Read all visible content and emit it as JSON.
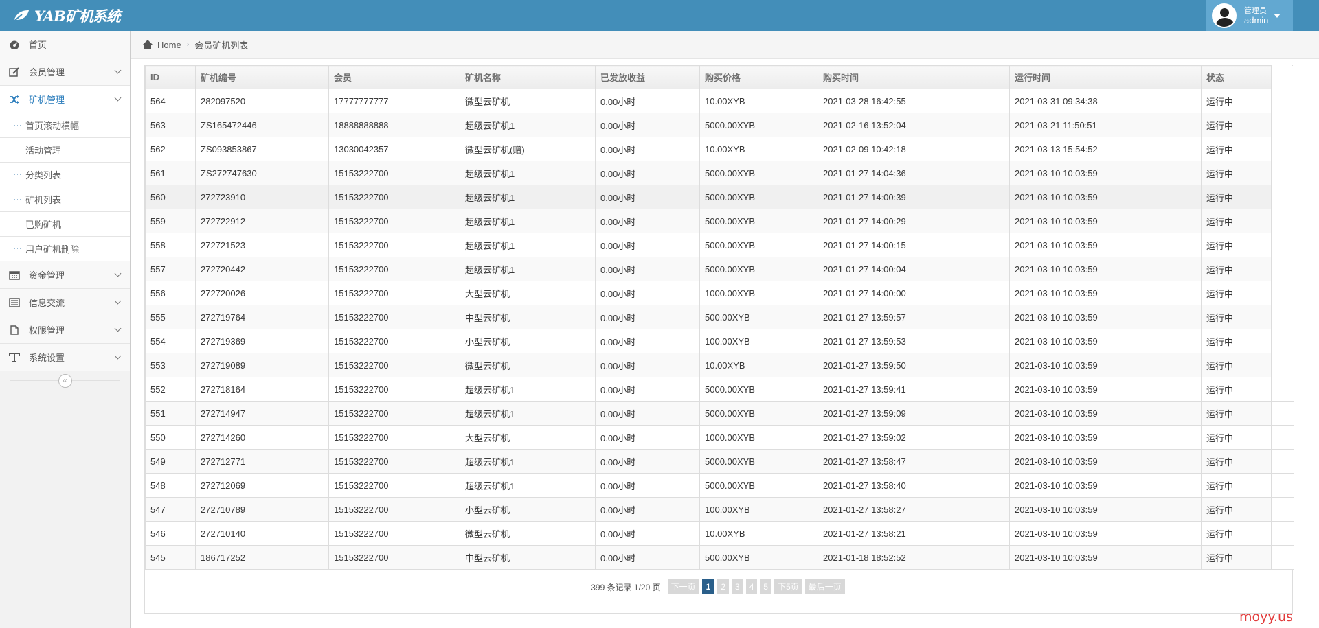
{
  "brand": {
    "title": "YAB矿机系统",
    "icon": "leaf-icon"
  },
  "user": {
    "role": "管理员",
    "name": "admin"
  },
  "sidebar": {
    "items": [
      {
        "label": "首页",
        "icon": "dashboard-icon"
      },
      {
        "label": "会员管理",
        "icon": "edit-icon"
      },
      {
        "label": "矿机管理",
        "icon": "shuffle-icon"
      },
      {
        "label": "资金管理",
        "icon": "calendar-icon"
      },
      {
        "label": "信息交流",
        "icon": "list-icon"
      },
      {
        "label": "权限管理",
        "icon": "file-icon"
      },
      {
        "label": "系统设置",
        "icon": "text-icon"
      }
    ],
    "sub_items": [
      "首页滚动横幅",
      "活动管理",
      "分类列表",
      "矿机列表",
      "已购矿机",
      "用户矿机删除"
    ],
    "collapse": "«"
  },
  "breadcrumb": {
    "home": "Home",
    "current": "会员矿机列表"
  },
  "table": {
    "headers": [
      "ID",
      "矿机编号",
      "会员",
      "矿机名称",
      "已发放收益",
      "购买价格",
      "购买时间",
      "运行时间",
      "状态"
    ],
    "rows": [
      [
        "564",
        "282097520",
        "17777777777",
        "微型云矿机",
        "0.00小时",
        "10.00XYB",
        "2021-03-28 16:42:55",
        "2021-03-31 09:34:38",
        "运行中"
      ],
      [
        "563",
        "ZS165472446",
        "18888888888",
        "超级云矿机1",
        "0.00小时",
        "5000.00XYB",
        "2021-02-16 13:52:04",
        "2021-03-21 11:50:51",
        "运行中"
      ],
      [
        "562",
        "ZS093853867",
        "13030042357",
        "微型云矿机(赠)",
        "0.00小时",
        "10.00XYB",
        "2021-02-09 10:42:18",
        "2021-03-13 15:54:52",
        "运行中"
      ],
      [
        "561",
        "ZS272747630",
        "15153222700",
        "超级云矿机1",
        "0.00小时",
        "5000.00XYB",
        "2021-01-27 14:04:36",
        "2021-03-10 10:03:59",
        "运行中"
      ],
      [
        "560",
        "272723910",
        "15153222700",
        "超级云矿机1",
        "0.00小时",
        "5000.00XYB",
        "2021-01-27 14:00:39",
        "2021-03-10 10:03:59",
        "运行中"
      ],
      [
        "559",
        "272722912",
        "15153222700",
        "超级云矿机1",
        "0.00小时",
        "5000.00XYB",
        "2021-01-27 14:00:29",
        "2021-03-10 10:03:59",
        "运行中"
      ],
      [
        "558",
        "272721523",
        "15153222700",
        "超级云矿机1",
        "0.00小时",
        "5000.00XYB",
        "2021-01-27 14:00:15",
        "2021-03-10 10:03:59",
        "运行中"
      ],
      [
        "557",
        "272720442",
        "15153222700",
        "超级云矿机1",
        "0.00小时",
        "5000.00XYB",
        "2021-01-27 14:00:04",
        "2021-03-10 10:03:59",
        "运行中"
      ],
      [
        "556",
        "272720026",
        "15153222700",
        "大型云矿机",
        "0.00小时",
        "1000.00XYB",
        "2021-01-27 14:00:00",
        "2021-03-10 10:03:59",
        "运行中"
      ],
      [
        "555",
        "272719764",
        "15153222700",
        "中型云矿机",
        "0.00小时",
        "500.00XYB",
        "2021-01-27 13:59:57",
        "2021-03-10 10:03:59",
        "运行中"
      ],
      [
        "554",
        "272719369",
        "15153222700",
        "小型云矿机",
        "0.00小时",
        "100.00XYB",
        "2021-01-27 13:59:53",
        "2021-03-10 10:03:59",
        "运行中"
      ],
      [
        "553",
        "272719089",
        "15153222700",
        "微型云矿机",
        "0.00小时",
        "10.00XYB",
        "2021-01-27 13:59:50",
        "2021-03-10 10:03:59",
        "运行中"
      ],
      [
        "552",
        "272718164",
        "15153222700",
        "超级云矿机1",
        "0.00小时",
        "5000.00XYB",
        "2021-01-27 13:59:41",
        "2021-03-10 10:03:59",
        "运行中"
      ],
      [
        "551",
        "272714947",
        "15153222700",
        "超级云矿机1",
        "0.00小时",
        "5000.00XYB",
        "2021-01-27 13:59:09",
        "2021-03-10 10:03:59",
        "运行中"
      ],
      [
        "550",
        "272714260",
        "15153222700",
        "大型云矿机",
        "0.00小时",
        "1000.00XYB",
        "2021-01-27 13:59:02",
        "2021-03-10 10:03:59",
        "运行中"
      ],
      [
        "549",
        "272712771",
        "15153222700",
        "超级云矿机1",
        "0.00小时",
        "5000.00XYB",
        "2021-01-27 13:58:47",
        "2021-03-10 10:03:59",
        "运行中"
      ],
      [
        "548",
        "272712069",
        "15153222700",
        "超级云矿机1",
        "0.00小时",
        "5000.00XYB",
        "2021-01-27 13:58:40",
        "2021-03-10 10:03:59",
        "运行中"
      ],
      [
        "547",
        "272710789",
        "15153222700",
        "小型云矿机",
        "0.00小时",
        "100.00XYB",
        "2021-01-27 13:58:27",
        "2021-03-10 10:03:59",
        "运行中"
      ],
      [
        "546",
        "272710140",
        "15153222700",
        "微型云矿机",
        "0.00小时",
        "10.00XYB",
        "2021-01-27 13:58:21",
        "2021-03-10 10:03:59",
        "运行中"
      ],
      [
        "545",
        "186717252",
        "15153222700",
        "中型云矿机",
        "0.00小时",
        "500.00XYB",
        "2021-01-18 18:52:52",
        "2021-03-10 10:03:59",
        "运行中"
      ]
    ]
  },
  "pagination": {
    "total": "399 条记录 1/20 页",
    "prev": "下一页",
    "pages": [
      "1",
      "2",
      "3",
      "4",
      "5"
    ],
    "next5": "下5页",
    "last": "最后一页"
  },
  "watermark": "moyy.us",
  "colors": {
    "navbar": "#438eb9",
    "user_box": "#62a8d1",
    "active": "#2b7dbc",
    "page_current": "#2a5f8a"
  }
}
